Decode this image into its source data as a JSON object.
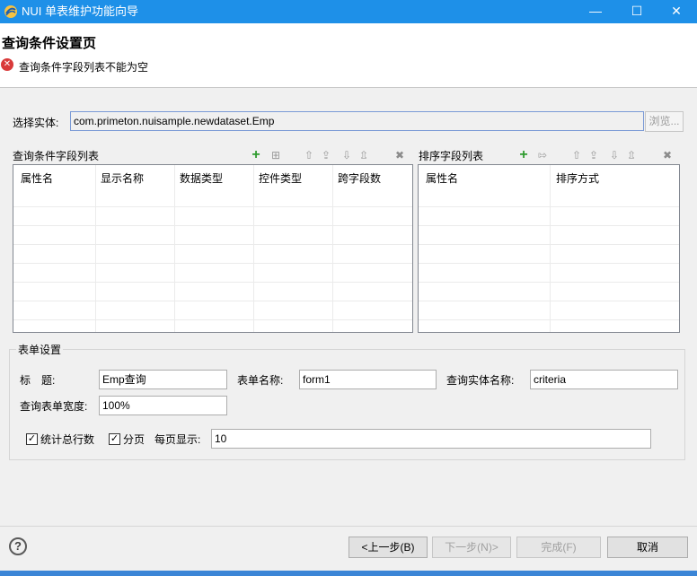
{
  "window": {
    "title": "NUI 单表维护功能向导",
    "minimize": "—",
    "maximize": "☐",
    "close": "✕"
  },
  "header": {
    "page_title": "查询条件设置页",
    "error_icon": "x-circle-icon",
    "error_message": "查询条件字段列表不能为空"
  },
  "entity": {
    "label": "选择实体:",
    "value": "com.primeton.nuisample.newdataset.Emp",
    "browse_label": "浏览..."
  },
  "query_fields": {
    "title": "查询条件字段列表",
    "columns": [
      "属性名",
      "显示名称",
      "数据类型",
      "控件类型",
      "跨字段数"
    ],
    "toolbar": {
      "add": "+",
      "insert": "⊞",
      "move_up": "⇧",
      "move_top": "⇪",
      "move_down": "⇩",
      "move_bottom": "⇫",
      "delete": "✖"
    }
  },
  "sort_fields": {
    "title": "排序字段列表",
    "columns": [
      "属性名",
      "排序方式"
    ],
    "toolbar": {
      "add": "+",
      "insert": "⇰",
      "move_up": "⇧",
      "move_top": "⇪",
      "move_down": "⇩",
      "move_bottom": "⇫",
      "delete": "✖"
    }
  },
  "form_settings": {
    "group_title": "表单设置",
    "title_label": "标　题:",
    "title_value": "Emp查询",
    "form_name_label": "表单名称:",
    "form_name_value": "form1",
    "query_entity_label": "查询实体名称:",
    "query_entity_value": "criteria",
    "width_label": "查询表单宽度:",
    "width_value": "100%",
    "count_total_label": "统计总行数",
    "count_total_checked": true,
    "paging_label": "分页",
    "paging_checked": true,
    "page_size_label": "每页显示:",
    "page_size_value": "10"
  },
  "buttons": {
    "help": "?",
    "back": "<上一步(B)",
    "next": "下一步(N)>",
    "finish": "完成(F)",
    "cancel": "取消"
  },
  "colors": {
    "titlebar": "#1e90e8",
    "error": "#d93a3a",
    "add_icon": "#2e9b2e"
  }
}
